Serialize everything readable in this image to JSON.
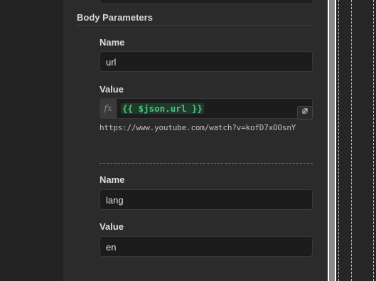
{
  "section": {
    "title": "Body Parameters"
  },
  "params": [
    {
      "name_label": "Name",
      "name_value": "url",
      "value_label": "Value",
      "value_expression": "{{ $json.url }}",
      "value_result": "https://www.youtube.com/watch?v=kofD7xOOsnY"
    },
    {
      "name_label": "Name",
      "name_value": "lang",
      "value_label": "Value",
      "value_text": "en"
    }
  ],
  "icons": {
    "fx": "fx",
    "expand": "expand-icon"
  },
  "colors": {
    "panel_bg": "#2b2b2b",
    "input_bg": "#1c1c1c",
    "expression_green": "#4fc17f"
  }
}
